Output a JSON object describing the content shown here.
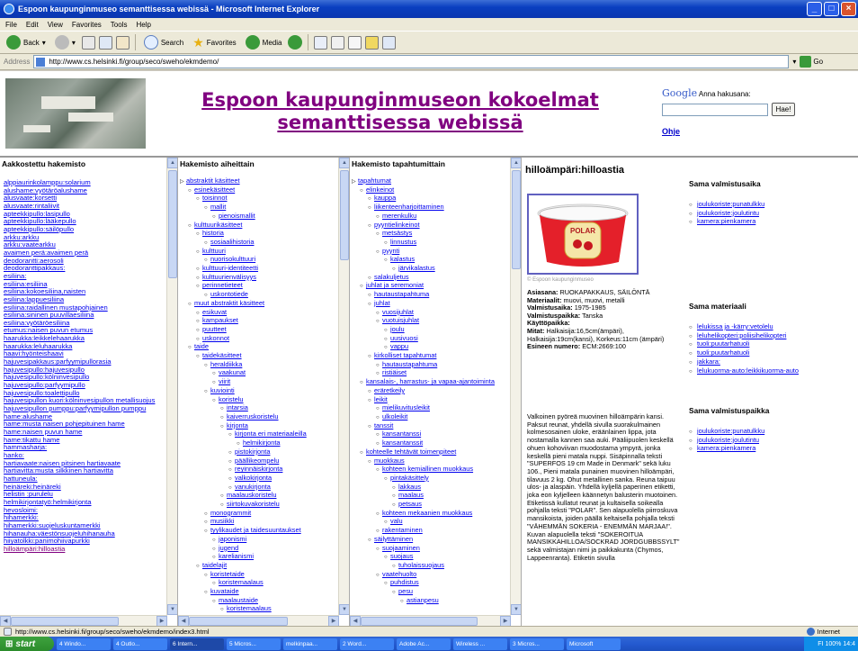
{
  "window": {
    "title": "Espoon kaupunginmuseo semanttisessa webissä - Microsoft Internet Explorer"
  },
  "menu": [
    "File",
    "Edit",
    "View",
    "Favorites",
    "Tools",
    "Help"
  ],
  "toolbar": {
    "back": "Back",
    "search": "Search",
    "favorites": "Favorites",
    "media": "Media"
  },
  "address": {
    "label": "Address",
    "url": "http://www.cs.helsinki.fi/group/seco/sweho/ekmdemo/",
    "go": "Go"
  },
  "banner": {
    "title": "Espoon kaupunginmuseon kokoelmat semanttisessa webissä",
    "google": "Google",
    "search_label": "Anna hakusana:",
    "search_value": "",
    "search_button": "Hae!",
    "help": "Ohje"
  },
  "col1": {
    "title": "Aakkostettu hakemisto",
    "items": [
      "alppiaurinkolamppu:solarium",
      "alushame:vyötärö­alushame",
      "alusvaate:korsetti",
      "alusvaate:rintaliivit",
      "apteekkipullo:lasipullo",
      "apteekkipullo:lääkepullo",
      "apteekkipullo:säilöpullo",
      "arkku:arkku",
      "arkku:vaatearkku",
      "avaimen perä:avaimen perä",
      "deodorantti:aerosoli",
      "deodoranttipakkaus:",
      "esiliina:",
      "esiliina:esiliina",
      "esiliina:kokoesiliina,naisten",
      "esiliina:lappuesiliina",
      "esiliina:raidallinen mustapohjainen",
      "esiliina:sininen puuvillaesiliina",
      "esiliina:vyötäröesiliina",
      "etumus:naisen puvun etumus",
      "haarukka:leikkelehaarukka",
      "haarukka:leluhaarukka",
      "haavi:hyönteishaavi",
      "hajuvesipakkaus:parfyymipullorasia",
      "hajuvesipullo:hajuvesipullo",
      "hajuvesipullo:kölninvesipullo",
      "hajuvesipullo:parfyymipullo",
      "hajuvesipullo:toalettipullo",
      "hajuvesipullon kuori:kölninvesipullon metallisuojus",
      "hajuvesipullon pumppu:parfyymipullon pumppu",
      "hame:alushame",
      "hame:musta naisen pohjepituinen hame",
      "hame:naisen puvun hame",
      "hame:tikattu hame",
      "hammasharja:",
      "hanko:",
      "hartiavaate:naisen pitsinen hartiavaate",
      "hartiavitta:musta silkkinen hartiavitta",
      "hattuneula:",
      "heinäreki:heinäreki",
      "helistin :purulelu",
      "helmikirjontatyö:helmikirjonta",
      "hevosloimi:",
      "hihamerkki:",
      "hihamerkki:suojeluskuntamerkki",
      "hihanauha:väestönsuojeluhihanauha",
      "hiiyatolkki:panimohiivapurkki",
      "hilloämpäri:hilloastia"
    ]
  },
  "col2": {
    "title": "Hakemisto aiheittain",
    "items": [
      {
        "t": "abstraktit käsitteet",
        "d": 0
      },
      {
        "t": "esinekäsitteet",
        "d": 1
      },
      {
        "t": "toisinnot",
        "d": 2
      },
      {
        "t": "mallit",
        "d": 3
      },
      {
        "t": "pienoismallit",
        "d": 4
      },
      {
        "t": "kulttuurikäsitteet",
        "d": 1
      },
      {
        "t": "historia",
        "d": 2
      },
      {
        "t": "sosiaalihistoria",
        "d": 3
      },
      {
        "t": "kulttuuri",
        "d": 2
      },
      {
        "t": "nuorisokulttuuri",
        "d": 3
      },
      {
        "t": "kulttuuri-identiteetti",
        "d": 2
      },
      {
        "t": "kulttuurienvälisyys",
        "d": 2
      },
      {
        "t": "perinnetieteet",
        "d": 2
      },
      {
        "t": "uskontotiede",
        "d": 3
      },
      {
        "t": "muut abstraktit käsitteet",
        "d": 1
      },
      {
        "t": "esikuvat",
        "d": 2
      },
      {
        "t": "kampaukset",
        "d": 2
      },
      {
        "t": "puutteet",
        "d": 2
      },
      {
        "t": "uskonnot",
        "d": 2
      },
      {
        "t": "taide",
        "d": 1
      },
      {
        "t": "taidekäsitteet",
        "d": 2
      },
      {
        "t": "heraldiikka",
        "d": 3
      },
      {
        "t": "vaakunat",
        "d": 4
      },
      {
        "t": "viirit",
        "d": 4
      },
      {
        "t": "kuviointi",
        "d": 3
      },
      {
        "t": "koristelu",
        "d": 4
      },
      {
        "t": "intarsia",
        "d": 5
      },
      {
        "t": "kaiverruskoristelu",
        "d": 5
      },
      {
        "t": "kirjonta",
        "d": 5
      },
      {
        "t": "kirjonta eri materiaaleilla",
        "d": 6
      },
      {
        "t": "helmikirjonta",
        "d": 7
      },
      {
        "t": "pistokirjonta",
        "d": 6
      },
      {
        "t": "päällikeompelu",
        "d": 6
      },
      {
        "t": "reyinnäiskirjonta",
        "d": 6
      },
      {
        "t": "valkokirjonta",
        "d": 6
      },
      {
        "t": "vanukirjonta",
        "d": 6
      },
      {
        "t": "maalauskoristelu",
        "d": 5
      },
      {
        "t": "siirtokuvakoristelu",
        "d": 5
      },
      {
        "t": "monogrammit",
        "d": 3
      },
      {
        "t": "musiikki",
        "d": 3
      },
      {
        "t": "tyylikaudet ja taidesuuntaukset",
        "d": 3
      },
      {
        "t": "japonismi",
        "d": 4
      },
      {
        "t": "jugend",
        "d": 4
      },
      {
        "t": "karelianismi",
        "d": 4
      },
      {
        "t": "taidelajit",
        "d": 2
      },
      {
        "t": "koristetaide",
        "d": 3
      },
      {
        "t": "koristemaalaus",
        "d": 4
      },
      {
        "t": "kuvataide",
        "d": 3
      },
      {
        "t": "maalaustaide",
        "d": 4
      },
      {
        "t": "koristemaalaus",
        "d": 5
      }
    ]
  },
  "col3": {
    "title": "Hakemisto tapahtumittain",
    "items": [
      {
        "t": "tapahtumat",
        "d": 0
      },
      {
        "t": "elinkeinot",
        "d": 1
      },
      {
        "t": "kauppa",
        "d": 2
      },
      {
        "t": "liikenteenharjoittaminen",
        "d": 2
      },
      {
        "t": "merenkulku",
        "d": 3
      },
      {
        "t": "pyyntielinkeinot",
        "d": 2
      },
      {
        "t": "metsästys",
        "d": 3
      },
      {
        "t": "linnustus",
        "d": 4
      },
      {
        "t": "pyynti",
        "d": 3
      },
      {
        "t": "kalastus",
        "d": 4
      },
      {
        "t": "järvikalastus",
        "d": 5
      },
      {
        "t": "salakuljetus",
        "d": 2
      },
      {
        "t": "juhlat ja seremoniat",
        "d": 1
      },
      {
        "t": "hautaustapahtuma",
        "d": 2
      },
      {
        "t": "juhlat",
        "d": 2
      },
      {
        "t": "vuosijuhlat",
        "d": 3
      },
      {
        "t": "vuotuisjuhlat",
        "d": 3
      },
      {
        "t": "joulu",
        "d": 4
      },
      {
        "t": "uusivuosi",
        "d": 4
      },
      {
        "t": "vappu",
        "d": 4
      },
      {
        "t": "kirkolliset tapahtumat",
        "d": 2
      },
      {
        "t": "hautaustapahtuma",
        "d": 3
      },
      {
        "t": "ristiäiset",
        "d": 3
      },
      {
        "t": "kansalais-, harrastus- ja vapaa-ajantoiminta",
        "d": 1
      },
      {
        "t": "eräretkeily",
        "d": 2
      },
      {
        "t": "leikit",
        "d": 2
      },
      {
        "t": "mielikuvitusleikit",
        "d": 3
      },
      {
        "t": "ulkoleikit",
        "d": 3
      },
      {
        "t": "tanssit",
        "d": 2
      },
      {
        "t": "kansantanssi",
        "d": 3
      },
      {
        "t": "kansantanssit",
        "d": 3
      },
      {
        "t": "kohteelle tehtävät toimenpiteet",
        "d": 1
      },
      {
        "t": "muokkaus",
        "d": 2
      },
      {
        "t": "kohteen kemiallinen muokkaus",
        "d": 3
      },
      {
        "t": "pintakäsittely",
        "d": 4
      },
      {
        "t": "lakkaus",
        "d": 5
      },
      {
        "t": "maalaus",
        "d": 5
      },
      {
        "t": "petsaus",
        "d": 5
      },
      {
        "t": "kohteen mekaanien muokkaus",
        "d": 3
      },
      {
        "t": "valu",
        "d": 4
      },
      {
        "t": "rakentaminen",
        "d": 3
      },
      {
        "t": "säilyttäminen",
        "d": 2
      },
      {
        "t": "suojaaminen",
        "d": 3
      },
      {
        "t": "suojaus",
        "d": 4
      },
      {
        "t": "tuholaissuojaus",
        "d": 5
      },
      {
        "t": "vaatehuolto",
        "d": 3
      },
      {
        "t": "puhdistus",
        "d": 4
      },
      {
        "t": "pesu",
        "d": 5
      },
      {
        "t": "astianpesu",
        "d": 6
      }
    ]
  },
  "detail": {
    "title": "hilloämpäri:hilloastia",
    "copyright": "© Espoon kaupunginmuseo",
    "label_text": "POLAR",
    "meta": [
      {
        "k": "Asiasana:",
        "v": " RUOKAPAKKAUS, SÄILÖNTÄ"
      },
      {
        "k": "Materiaalit:",
        "v": " muovi, muovi, metalli"
      },
      {
        "k": "Valmistusaika:",
        "v": " 1975-1985"
      },
      {
        "k": "Valmistuspaikka:",
        "v": " Tanska"
      },
      {
        "k": "Käyttöpaikka:",
        "v": ""
      },
      {
        "k": "Mitat:",
        "v": " Halkaisija:16,5cm(ämpäri), Halkaisija:19cm(kansi), Korkeus:11cm (ämpäri)"
      },
      {
        "k": "Esineen numero:",
        "v": " ECM:2669:100"
      }
    ],
    "description": "Valkoinen pyöreä muovinen hilloämpärin kansi. Paksut reunat, yhdellä sivulla suorakulmainen kolmesosainen uloke, eräänlainen lippa, jota nostamalla kannen saa auki. Pääliipuolen keskellä ohuen kohoviivan muodostama ympyrä, jonka keskellä pieni matala nuppi. Sisäpinnalla teksti \"SUPERFOS 19 cm Made in Denmark\" sekä luku 106., Pieni matala punainen muovinen hilloämpäri, tilavuus 2 kg. Ohut metallinen sanka. Reuna taipuu ulos- ja alaspäin. Yhdellä kyljellä paperinen etiketti, joka eon kyljelleen käännetyn balusterin muotoinen. Etiketissä kullatut reunat ja kultaisella soikealla pohjalla teksti \"POLAR\". Sen alapuolella piirroskuva mansikoista, joiden päällä keltaisella pohjalla teksti \"VÄHEMMÄN SOKERIA - ENEMMÄN MARJAA!\". Kuvan alapuolella teksti \"SOKEROITUA MANSIKKAHILLOA/SOCKRAD JORDGUBBSSYLT\" sekä valmistajan nimi ja paikkakunta (Chymos, Lappeenranta). Etiketin sivulla",
    "sections": [
      {
        "h": "Sama valmistusaika",
        "items": [
          "joulukoriste:punatulkku",
          "joulukoriste:joulutintu",
          "kamera:pienkamera"
        ]
      },
      {
        "h": "Sama materiaali",
        "items": [
          "lelukissa ja -kärry:vetolelu",
          "leluhelikopteri:poliisihelikopteri",
          "tuoli:puutarhatuoli",
          "tuoli:puutarhatuoli",
          "jakkara:",
          "lelukuorma-auto:leikkikuorma-auto"
        ]
      },
      {
        "h": "Sama valmistuspaikka",
        "items": [
          "joulukoriste:punatulkku",
          "joulukoriste:joulutintu",
          "kamera:pienkamera"
        ]
      }
    ]
  },
  "status": {
    "url": "http://www.cs.helsinki.fi/group/seco/sweho/ekmdemo/index3.html",
    "zone": "Internet"
  },
  "taskbar": {
    "start": "start",
    "tasks": [
      "4 Windo...",
      "4 Outlo...",
      "6 Intern...",
      "5 Micros...",
      "melkinpaa...",
      "2 Word...",
      "Adobe Ac...",
      "Wireless ...",
      "3 Micros...",
      "Microsoft"
    ],
    "lang": "FI",
    "battery": "100%",
    "clock": "14:4"
  }
}
